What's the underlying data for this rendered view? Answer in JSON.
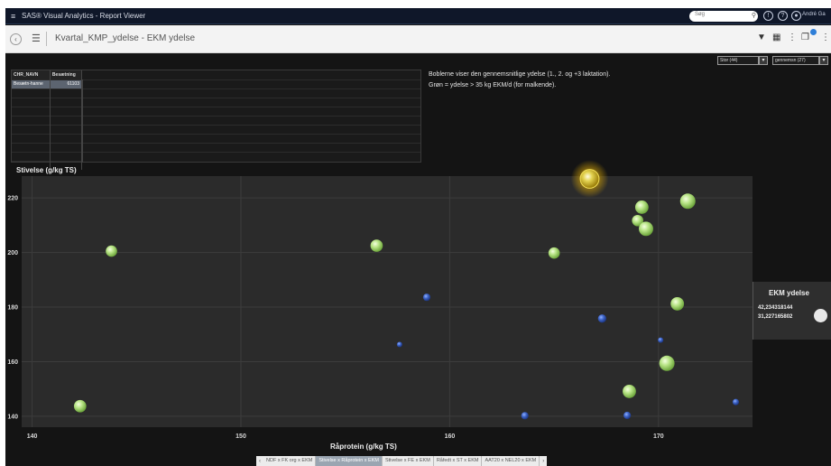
{
  "topbar": {
    "menu_icon": "menu-icon",
    "title": "SAS® Visual Analytics - Report Viewer",
    "search_placeholder": "Søg",
    "user_name": "André Ga"
  },
  "toolbar": {
    "report_title": "Kvartal_KMP_ydelse - EKM ydelse"
  },
  "table": {
    "columns": [
      "CHR_NAVN",
      "Besætning"
    ],
    "rows": [
      {
        "name": "Besætn-hanne",
        "value": "61103",
        "selected": true
      }
    ],
    "empty_rows": 9
  },
  "info": {
    "line1": "Boblerne viser den gennemsnitlige ydelse (1., 2. og +3 laktation).",
    "line2": "Grøn = ydelse > 35 kg EKM/d (for malkende)."
  },
  "filters": {
    "race": "Stor (44)",
    "period": "gennemsn (27)"
  },
  "chart_data": {
    "type": "scatter",
    "title": "",
    "xlabel": "Råprotein (g/kg TS)",
    "ylabel": "Stivelse (g/kg TS)",
    "xlim": [
      139.5,
      174.5
    ],
    "ylim": [
      136,
      228
    ],
    "xticks": [
      140,
      150,
      160,
      170
    ],
    "yticks": [
      140,
      160,
      180,
      200,
      220
    ],
    "size_label": "EKM ydelse",
    "size_max": "42,234318144",
    "size_min": "31,227165802",
    "colors": {
      "high": "#9ed86a",
      "low": "#2f53ad",
      "selected": "#d9c21a"
    },
    "points": [
      {
        "x": 142.3,
        "y": 143.7,
        "size": 38,
        "group": "high"
      },
      {
        "x": 143.8,
        "y": 200.5,
        "size": 37,
        "group": "high"
      },
      {
        "x": 156.5,
        "y": 202.5,
        "size": 38,
        "group": "high"
      },
      {
        "x": 157.6,
        "y": 166.3,
        "size": 31,
        "group": "low"
      },
      {
        "x": 158.9,
        "y": 183.6,
        "size": 33,
        "group": "low"
      },
      {
        "x": 163.6,
        "y": 140.2,
        "size": 33,
        "group": "low"
      },
      {
        "x": 165.0,
        "y": 199.8,
        "size": 37,
        "group": "high"
      },
      {
        "x": 166.7,
        "y": 227.0,
        "size": 42,
        "group": "selected"
      },
      {
        "x": 167.3,
        "y": 175.8,
        "size": 34,
        "group": "low"
      },
      {
        "x": 168.5,
        "y": 140.3,
        "size": 33,
        "group": "low"
      },
      {
        "x": 168.6,
        "y": 149.1,
        "size": 39,
        "group": "high"
      },
      {
        "x": 169.0,
        "y": 211.7,
        "size": 37,
        "group": "high"
      },
      {
        "x": 169.2,
        "y": 216.6,
        "size": 39,
        "group": "high"
      },
      {
        "x": 169.4,
        "y": 208.7,
        "size": 40,
        "group": "high"
      },
      {
        "x": 170.1,
        "y": 167.9,
        "size": 31,
        "group": "low"
      },
      {
        "x": 170.4,
        "y": 159.4,
        "size": 41,
        "group": "high"
      },
      {
        "x": 170.9,
        "y": 181.2,
        "size": 39,
        "group": "high"
      },
      {
        "x": 171.4,
        "y": 218.8,
        "size": 41,
        "group": "high"
      },
      {
        "x": 173.7,
        "y": 145.2,
        "size": 32,
        "group": "low"
      }
    ]
  },
  "tabs": [
    {
      "label": "NDF x FK org x EKM",
      "active": false
    },
    {
      "label": "Stivelse x Råprotein x EKM",
      "active": true
    },
    {
      "label": "Stivelse x FE x EKM",
      "active": false
    },
    {
      "label": "Råfedt x ST x EKM",
      "active": false
    },
    {
      "label": "AAT20 x NEL20 x EKM",
      "active": false
    }
  ]
}
